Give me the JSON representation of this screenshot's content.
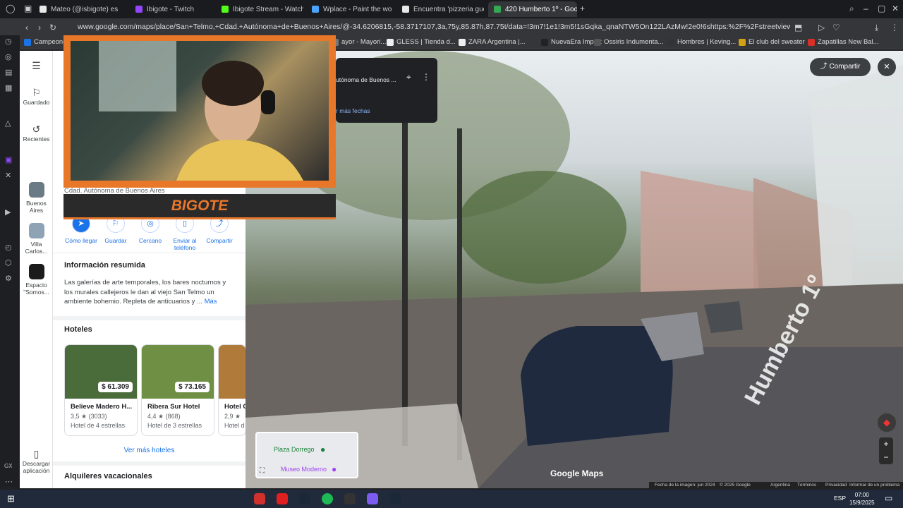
{
  "tabs": [
    {
      "label": "Mateo (@isbigote) es",
      "color": "#e8e8e8"
    },
    {
      "label": "Ibigote - Twitch",
      "color": "#9146ff"
    },
    {
      "label": "Ibigote Stream - Watch L",
      "color": "#53fc18"
    },
    {
      "label": "Wplace - Paint the world",
      "color": "#4aa3ff"
    },
    {
      "label": "Encuentra 'pizzeria guer",
      "color": "#e8e8e8"
    },
    {
      "label": "420 Humberto 1º - Googl",
      "color": "#34a853"
    }
  ],
  "url": "www.google.com/maps/place/San+Telmo,+Cdad.+Autónoma+de+Buenos+Aires/@-34.6206815,-58.3717107,3a,75y,85.87h,87.75t/data=!3m7!1e1!3m5!1sGqka_qnaNTW5On122LAzMw!2e0!6shttps:%2F%2Fstreetviewpixels-pa.googleapis.com%2",
  "bookmarks": [
    {
      "label": "Campeone",
      "color": "#1a73e8"
    },
    {
      "label": "ayor - Mayori...",
      "color": "#777"
    },
    {
      "label": "GLESS | Tienda d...",
      "color": "#eee"
    },
    {
      "label": "ZARA Argentina |...",
      "color": "#eee"
    },
    {
      "label": "NuevaEra Import",
      "color": "#222"
    },
    {
      "label": "Ossiris Indumenta...",
      "color": "#555"
    },
    {
      "label": "Hombres | Keving...",
      "color": "#333"
    },
    {
      "label": "El club del sweater",
      "color": "#d4a017"
    },
    {
      "label": "Zapatillas New Bal...",
      "color": "#d93025"
    }
  ],
  "rail": {
    "menu_icon": "hamburger-icon",
    "saved": "Guardado",
    "recent": "Recientes",
    "recent_places": [
      {
        "label": "Buenos Aires",
        "color": "#6b7b86"
      },
      {
        "label": "Villa Carlos...",
        "color": "#8ea3b4"
      },
      {
        "label": "Espacio \"Somos...",
        "color": "#1b1b1b"
      }
    ],
    "download": "Descargar aplicación"
  },
  "panel": {
    "address": "Cdad. Autónoma de Buenos Aires",
    "actions": [
      "Cómo llegar",
      "Guardar",
      "Cercano",
      "Enviar al teléfono",
      "Compartir"
    ],
    "summary_title": "Información resumida",
    "summary_text": "Las galerías de arte temporales, los bares nocturnos y los murales callejeros le dan al viejo San Telmo un ambiente bohemio. Repleta de anticuarios y ...",
    "summary_more": "Más",
    "hotels_title": "Hoteles",
    "hotels": [
      {
        "name": "Believe Madero H...",
        "price": "$ 61.309",
        "rating": "3,5 ★ (3033)",
        "type": "Hotel de 4 estrellas",
        "color": "#4a6b3a"
      },
      {
        "name": "Ribera Sur Hotel",
        "price": "$ 73.165",
        "rating": "4,4 ★ (868)",
        "type": "Hotel de 3 estrellas",
        "color": "#6f8f45"
      },
      {
        "name": "Hotel C",
        "price": "",
        "rating": "2,9 ★",
        "type": "Hotel d",
        "color": "#b07a3a"
      }
    ],
    "more_hotels": "Ver más hoteles",
    "rentals_title": "Alquileres vacacionales"
  },
  "street": {
    "info_place": "utónoma de Buenos ...",
    "info_more_dates": "r más fechas",
    "share": "Compartir",
    "street_label": "Humberto 1º",
    "watermark": "Google Maps",
    "minimap_labels": [
      "Plaza Dorrego",
      "Museo Moderno"
    ],
    "footer": [
      "Fecha de la imagen: jun 2024",
      "© 2025 Google",
      "Argentina",
      "Términos",
      "Privacidad",
      "Informar de un problema"
    ]
  },
  "stream": {
    "overlay_name": "BIGOTE"
  },
  "taskbar": {
    "lang": "ESP",
    "time": "07:00",
    "date": "15/9/2025"
  },
  "colors": {
    "accent": "#1a73e8",
    "stream_orange": "#e8772a"
  }
}
